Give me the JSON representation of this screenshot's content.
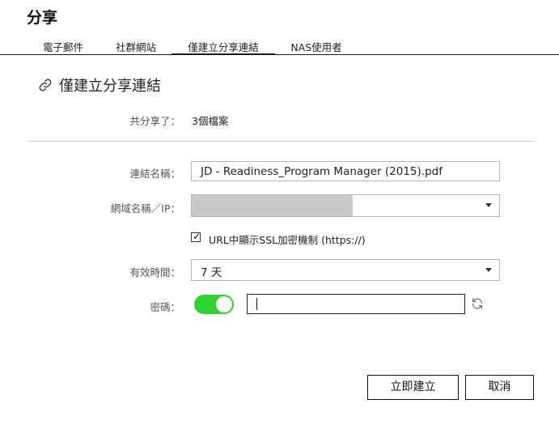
{
  "dialog": {
    "title": "分享"
  },
  "tabs": [
    {
      "label": "電子郵件"
    },
    {
      "label": "社群網站"
    },
    {
      "label": "僅建立分享連結",
      "active": true
    },
    {
      "label": "NAS使用者"
    }
  ],
  "section": {
    "title": "僅建立分享連結",
    "icon": "link-icon"
  },
  "summary": {
    "label": "共分享了：",
    "value": "3個檔案"
  },
  "form": {
    "link_name": {
      "label": "連結名稱：",
      "value": "JD - Readiness_Program Manager (2015).pdf"
    },
    "domain": {
      "label": "網域名稱／IP：",
      "value": ""
    },
    "ssl": {
      "label": "URL中顯示SSL加密機制 (https://)",
      "checked": true
    },
    "validity": {
      "label": "有效時間：",
      "value": "7 天"
    },
    "password": {
      "label": "密碼：",
      "enabled": true,
      "value": ""
    }
  },
  "buttons": {
    "create": "立即建立",
    "cancel": "取消"
  },
  "colors": {
    "toggle_on": "#2fd32f",
    "accent": "#1a1a1a"
  }
}
